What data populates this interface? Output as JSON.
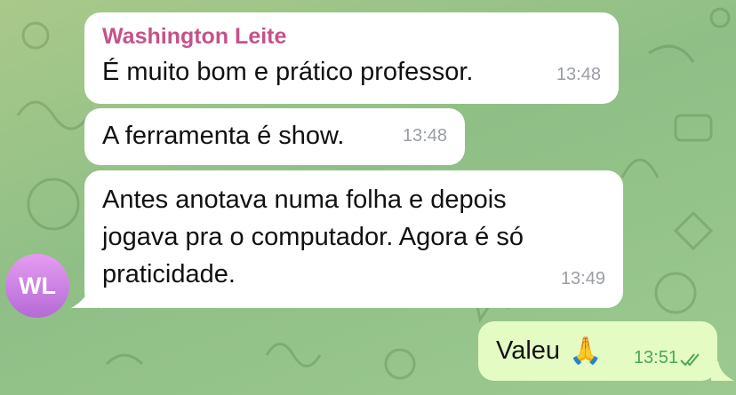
{
  "chat": {
    "messages": [
      {
        "sender": "Washington Leite",
        "text": "É muito bom e prático professor.",
        "time": "13:48"
      },
      {
        "text": "A ferramenta é show.",
        "time": "13:48"
      },
      {
        "line1": "Antes anotava numa folha e depois",
        "line2": "jogava pra o computador. Agora é só",
        "line3": "praticidade.",
        "time": "13:49"
      }
    ],
    "avatar_initials": "WL",
    "outgoing": {
      "text": "Valeu",
      "emoji": "🙏",
      "time": "13:51",
      "status_icon": "double-check-icon"
    }
  },
  "colors": {
    "sender": "#c5528a",
    "outgoing_bubble": "#e4fbc3",
    "read_check": "#4aa85a"
  }
}
